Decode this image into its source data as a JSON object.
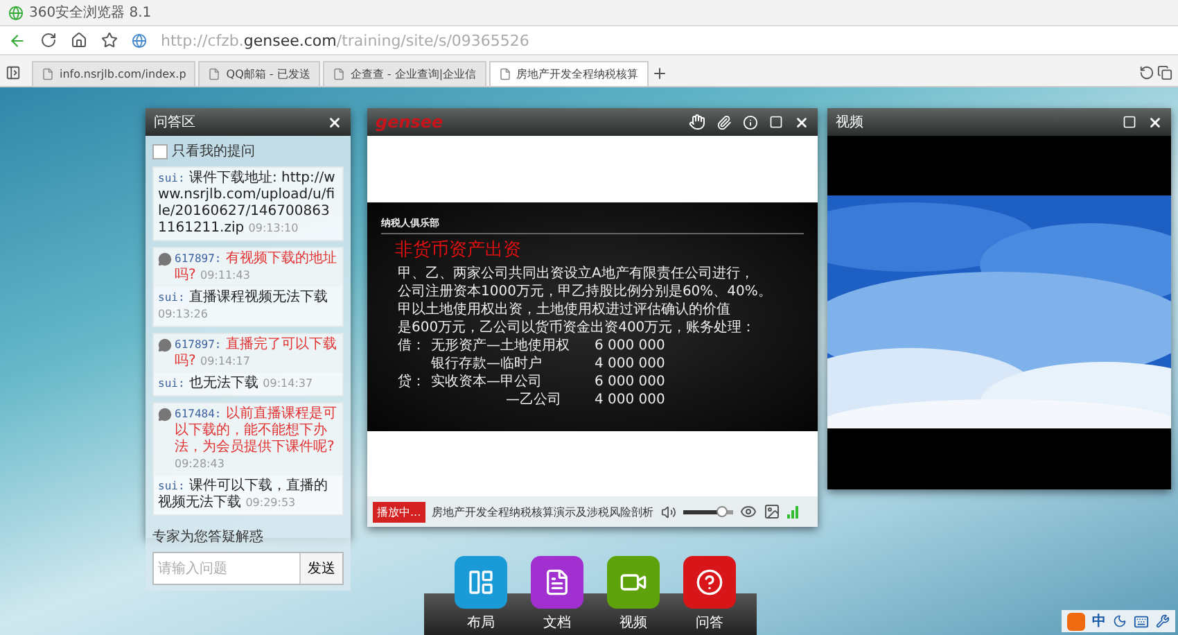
{
  "browser": {
    "title": "360安全浏览器 8.1",
    "url": "http://cfzb.**gensee.com**/training/site/s/09365526",
    "tabs": [
      {
        "label": "info.nsrjlb.com/index.p",
        "selected": false
      },
      {
        "label": "QQ邮箱 - 已发送",
        "selected": false
      },
      {
        "label": "企查查 - 企业查询|企业信",
        "selected": false
      },
      {
        "label": "房地产开发全程纳税核算",
        "selected": true
      }
    ]
  },
  "qa_panel": {
    "title": "问答区",
    "filter": {
      "label": "只看我的提问",
      "checked": false
    },
    "cards": [
      {
        "entries": [
          {
            "kind": "answer",
            "user": "sui:",
            "text": "课件下载地址: http://www.nsrjlb.com/upload/u/file/20160627/1467008631161211.zip",
            "time": "09:13:10"
          }
        ]
      },
      {
        "entries": [
          {
            "kind": "question",
            "user": "617897:",
            "text": "有视频下载的地址吗?",
            "time": "09:11:43"
          },
          {
            "kind": "answer",
            "user": "sui:",
            "text": "直播课程视频无法下载",
            "time": "09:13:26"
          }
        ]
      },
      {
        "entries": [
          {
            "kind": "question",
            "user": "617897:",
            "text": "直播完了可以下载吗?",
            "time": "09:14:17"
          },
          {
            "kind": "answer",
            "user": "sui:",
            "text": "也无法下载",
            "time": "09:14:37"
          }
        ]
      },
      {
        "entries": [
          {
            "kind": "question",
            "user": "617484:",
            "text": "以前直播课程是可以下载的，能不能想下办法，为会员提供下课件呢?",
            "time": "09:28:43"
          },
          {
            "kind": "answer",
            "user": "sui:",
            "text": "课件可以下载，直播的视频无法下载",
            "time": "09:29:53"
          }
        ]
      }
    ],
    "footer_label": "专家为您答疑解惑",
    "input": {
      "placeholder": "请输入问题"
    },
    "send_button": "发送"
  },
  "doc_panel": {
    "logo": "gensee",
    "slide": {
      "club": "纳税人俱乐部",
      "heading": "非货币资产出资",
      "lines": [
        "甲、乙、两家公司共同出资设立A地产有限责任公司进行，",
        "公司注册资本1000万元，甲乙持股比例分别是60%、40%。",
        "甲以土地使用权出资，土地使用权进过评估确认的价值",
        "是600万元，乙公司以货币资金出资400万元，账务处理："
      ],
      "entries": [
        {
          "side": "借：",
          "account": "无形资产—土地使用权",
          "amount": "6 000 000"
        },
        {
          "account": "银行存款—临时户",
          "amount": "4 000 000"
        },
        {
          "side": "贷：",
          "account": "实收资本—甲公司",
          "amount": "6 000 000"
        },
        {
          "account": "—乙公司",
          "amount": "4 000 000"
        }
      ]
    },
    "status": "播放中...",
    "course": "房地产开发全程纳税核算演示及涉税风险剖析",
    "volume": {
      "level": 0.8
    }
  },
  "video_panel": {
    "title": "视频"
  },
  "dock": [
    {
      "label": "布局",
      "kind": "layout",
      "color": "#1a9ad6"
    },
    {
      "label": "文档",
      "kind": "document",
      "color": "#a22fd0"
    },
    {
      "label": "视频",
      "kind": "video",
      "color": "#5fa30c"
    },
    {
      "label": "问答",
      "kind": "qa",
      "color": "#d8161a"
    }
  ],
  "ime": {
    "mode": "中"
  }
}
